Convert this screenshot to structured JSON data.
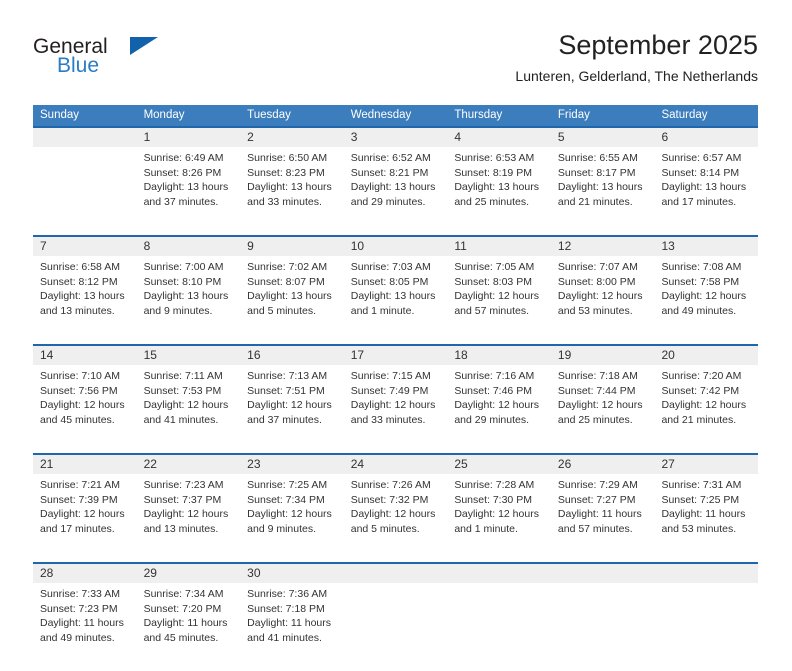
{
  "brand": {
    "name_part1": "General",
    "name_part2": "Blue",
    "triangle_color": "#1262ab",
    "blue_color": "#2b7cc4"
  },
  "header": {
    "title": "September 2025",
    "subtitle": "Lunteren, Gelderland, The Netherlands",
    "header_bg": "#3b7dbd",
    "separator_color": "#1f66ad",
    "daynum_band_color": "#efefef"
  },
  "weekdays": [
    "Sunday",
    "Monday",
    "Tuesday",
    "Wednesday",
    "Thursday",
    "Friday",
    "Saturday"
  ],
  "weeks": [
    [
      {
        "day": "",
        "sunrise": "",
        "sunset": "",
        "daylight1": "",
        "daylight2": ""
      },
      {
        "day": "1",
        "sunrise": "Sunrise: 6:49 AM",
        "sunset": "Sunset: 8:26 PM",
        "daylight1": "Daylight: 13 hours",
        "daylight2": "and 37 minutes."
      },
      {
        "day": "2",
        "sunrise": "Sunrise: 6:50 AM",
        "sunset": "Sunset: 8:23 PM",
        "daylight1": "Daylight: 13 hours",
        "daylight2": "and 33 minutes."
      },
      {
        "day": "3",
        "sunrise": "Sunrise: 6:52 AM",
        "sunset": "Sunset: 8:21 PM",
        "daylight1": "Daylight: 13 hours",
        "daylight2": "and 29 minutes."
      },
      {
        "day": "4",
        "sunrise": "Sunrise: 6:53 AM",
        "sunset": "Sunset: 8:19 PM",
        "daylight1": "Daylight: 13 hours",
        "daylight2": "and 25 minutes."
      },
      {
        "day": "5",
        "sunrise": "Sunrise: 6:55 AM",
        "sunset": "Sunset: 8:17 PM",
        "daylight1": "Daylight: 13 hours",
        "daylight2": "and 21 minutes."
      },
      {
        "day": "6",
        "sunrise": "Sunrise: 6:57 AM",
        "sunset": "Sunset: 8:14 PM",
        "daylight1": "Daylight: 13 hours",
        "daylight2": "and 17 minutes."
      }
    ],
    [
      {
        "day": "7",
        "sunrise": "Sunrise: 6:58 AM",
        "sunset": "Sunset: 8:12 PM",
        "daylight1": "Daylight: 13 hours",
        "daylight2": "and 13 minutes."
      },
      {
        "day": "8",
        "sunrise": "Sunrise: 7:00 AM",
        "sunset": "Sunset: 8:10 PM",
        "daylight1": "Daylight: 13 hours",
        "daylight2": "and 9 minutes."
      },
      {
        "day": "9",
        "sunrise": "Sunrise: 7:02 AM",
        "sunset": "Sunset: 8:07 PM",
        "daylight1": "Daylight: 13 hours",
        "daylight2": "and 5 minutes."
      },
      {
        "day": "10",
        "sunrise": "Sunrise: 7:03 AM",
        "sunset": "Sunset: 8:05 PM",
        "daylight1": "Daylight: 13 hours",
        "daylight2": "and 1 minute."
      },
      {
        "day": "11",
        "sunrise": "Sunrise: 7:05 AM",
        "sunset": "Sunset: 8:03 PM",
        "daylight1": "Daylight: 12 hours",
        "daylight2": "and 57 minutes."
      },
      {
        "day": "12",
        "sunrise": "Sunrise: 7:07 AM",
        "sunset": "Sunset: 8:00 PM",
        "daylight1": "Daylight: 12 hours",
        "daylight2": "and 53 minutes."
      },
      {
        "day": "13",
        "sunrise": "Sunrise: 7:08 AM",
        "sunset": "Sunset: 7:58 PM",
        "daylight1": "Daylight: 12 hours",
        "daylight2": "and 49 minutes."
      }
    ],
    [
      {
        "day": "14",
        "sunrise": "Sunrise: 7:10 AM",
        "sunset": "Sunset: 7:56 PM",
        "daylight1": "Daylight: 12 hours",
        "daylight2": "and 45 minutes."
      },
      {
        "day": "15",
        "sunrise": "Sunrise: 7:11 AM",
        "sunset": "Sunset: 7:53 PM",
        "daylight1": "Daylight: 12 hours",
        "daylight2": "and 41 minutes."
      },
      {
        "day": "16",
        "sunrise": "Sunrise: 7:13 AM",
        "sunset": "Sunset: 7:51 PM",
        "daylight1": "Daylight: 12 hours",
        "daylight2": "and 37 minutes."
      },
      {
        "day": "17",
        "sunrise": "Sunrise: 7:15 AM",
        "sunset": "Sunset: 7:49 PM",
        "daylight1": "Daylight: 12 hours",
        "daylight2": "and 33 minutes."
      },
      {
        "day": "18",
        "sunrise": "Sunrise: 7:16 AM",
        "sunset": "Sunset: 7:46 PM",
        "daylight1": "Daylight: 12 hours",
        "daylight2": "and 29 minutes."
      },
      {
        "day": "19",
        "sunrise": "Sunrise: 7:18 AM",
        "sunset": "Sunset: 7:44 PM",
        "daylight1": "Daylight: 12 hours",
        "daylight2": "and 25 minutes."
      },
      {
        "day": "20",
        "sunrise": "Sunrise: 7:20 AM",
        "sunset": "Sunset: 7:42 PM",
        "daylight1": "Daylight: 12 hours",
        "daylight2": "and 21 minutes."
      }
    ],
    [
      {
        "day": "21",
        "sunrise": "Sunrise: 7:21 AM",
        "sunset": "Sunset: 7:39 PM",
        "daylight1": "Daylight: 12 hours",
        "daylight2": "and 17 minutes."
      },
      {
        "day": "22",
        "sunrise": "Sunrise: 7:23 AM",
        "sunset": "Sunset: 7:37 PM",
        "daylight1": "Daylight: 12 hours",
        "daylight2": "and 13 minutes."
      },
      {
        "day": "23",
        "sunrise": "Sunrise: 7:25 AM",
        "sunset": "Sunset: 7:34 PM",
        "daylight1": "Daylight: 12 hours",
        "daylight2": "and 9 minutes."
      },
      {
        "day": "24",
        "sunrise": "Sunrise: 7:26 AM",
        "sunset": "Sunset: 7:32 PM",
        "daylight1": "Daylight: 12 hours",
        "daylight2": "and 5 minutes."
      },
      {
        "day": "25",
        "sunrise": "Sunrise: 7:28 AM",
        "sunset": "Sunset: 7:30 PM",
        "daylight1": "Daylight: 12 hours",
        "daylight2": "and 1 minute."
      },
      {
        "day": "26",
        "sunrise": "Sunrise: 7:29 AM",
        "sunset": "Sunset: 7:27 PM",
        "daylight1": "Daylight: 11 hours",
        "daylight2": "and 57 minutes."
      },
      {
        "day": "27",
        "sunrise": "Sunrise: 7:31 AM",
        "sunset": "Sunset: 7:25 PM",
        "daylight1": "Daylight: 11 hours",
        "daylight2": "and 53 minutes."
      }
    ],
    [
      {
        "day": "28",
        "sunrise": "Sunrise: 7:33 AM",
        "sunset": "Sunset: 7:23 PM",
        "daylight1": "Daylight: 11 hours",
        "daylight2": "and 49 minutes."
      },
      {
        "day": "29",
        "sunrise": "Sunrise: 7:34 AM",
        "sunset": "Sunset: 7:20 PM",
        "daylight1": "Daylight: 11 hours",
        "daylight2": "and 45 minutes."
      },
      {
        "day": "30",
        "sunrise": "Sunrise: 7:36 AM",
        "sunset": "Sunset: 7:18 PM",
        "daylight1": "Daylight: 11 hours",
        "daylight2": "and 41 minutes."
      },
      {
        "day": "",
        "sunrise": "",
        "sunset": "",
        "daylight1": "",
        "daylight2": ""
      },
      {
        "day": "",
        "sunrise": "",
        "sunset": "",
        "daylight1": "",
        "daylight2": ""
      },
      {
        "day": "",
        "sunrise": "",
        "sunset": "",
        "daylight1": "",
        "daylight2": ""
      },
      {
        "day": "",
        "sunrise": "",
        "sunset": "",
        "daylight1": "",
        "daylight2": ""
      }
    ]
  ]
}
